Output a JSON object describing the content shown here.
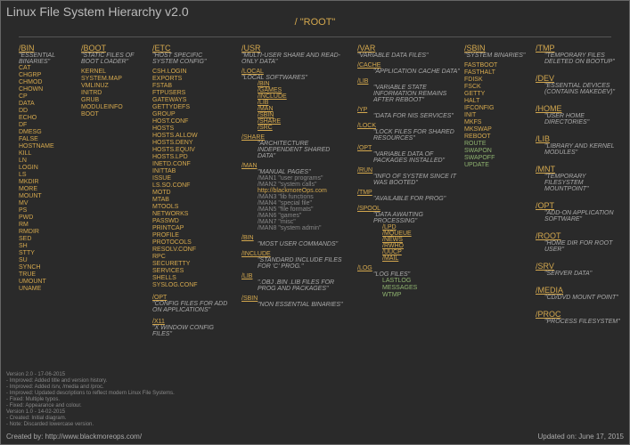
{
  "title": "Linux File System Hierarchy v2.0",
  "root": "/ \"ROOT\"",
  "cols": {
    "bin": {
      "label": "/BIN",
      "desc": "\"ESSENTIAL BINARIES\"",
      "items": [
        "CAT",
        "CHGRP",
        "CHMOD",
        "CHOWN",
        "CP",
        "DATA",
        "DD",
        "ECHO",
        "DF",
        "DMESG",
        "FALSE",
        "HOSTNAME",
        "KILL",
        "LN",
        "LOGIN",
        "LS",
        "MKDIR",
        "MORE",
        "MOUNT",
        "MV",
        "PS",
        "PWD",
        "RM",
        "RMDIR",
        "SED",
        "SH",
        "STTY",
        "SU",
        "SYNCH",
        "TRUE",
        "UMOUNT",
        "UNAME"
      ]
    },
    "boot": {
      "label": "/BOOT",
      "desc": "\"STATIC FILES OF BOOT LOADER\"",
      "items": [
        "KERNEL",
        "SYSTEM.MAP",
        "VMLINUZ",
        "INITRD",
        "GRUB",
        "MODULEINFO",
        "BOOT"
      ]
    },
    "etc": {
      "label": "/ETC",
      "desc": "\"HOST SPECIFIC SYSTEM CONFIG\"",
      "items": [
        "CSH.LOGIN",
        "EXPORTS",
        "FSTAB",
        "FTPUSERS",
        "GATEWAYS",
        "GETTYDEFS",
        "GROUP",
        "HOST.CONF",
        "HOSTS",
        "HOSTS.ALLOW",
        "HOSTS.DENY",
        "HOSTS.EQUIV",
        "HOSTS.LPD",
        "INETD.CONF",
        "INITTAB",
        "ISSUE",
        "LS.SO.CONF",
        "MOTD",
        "MTAB",
        "MTOOLS",
        "NETWORKS",
        "PASSWD",
        "PRINTCAP",
        "PROFILE",
        "PROTOCOLS",
        "RESOLV.CONF",
        "RPC",
        "SECURETTY",
        "SERVICES",
        "SHELLS",
        "SYSLOG.CONF"
      ],
      "opt": {
        "label": "/OPT",
        "desc": "\"CONFIG FILES FOR ADD ON APPLICATIONS\""
      },
      "x11": {
        "label": "/X11",
        "desc": "\"X WINDOW CONFIG FILES\""
      }
    },
    "usr": {
      "label": "/USR",
      "desc": "\"MULTI-USER SHARE AND READ-ONLY DATA\"",
      "local": {
        "label": "/LOCAL",
        "desc": "\"LOCAL SOFTWARES\"",
        "items": [
          "/BIN",
          "/GAMES",
          "/INCLUDE",
          "/LIB",
          "/MAN",
          "/SBIN",
          "/SHARE",
          "/SRC"
        ]
      },
      "share": {
        "label": "/SHARE",
        "desc": "\"ARCHITECTURE INDEPENDENT SHARED DATA\""
      },
      "man": {
        "label": "/MAN",
        "desc": "\"MANUAL PAGES\"",
        "items": [
          "/MAN1 \"user programs\"",
          "/MAN2 \"system calls\"",
          "/MAN3 \"lib functions",
          "/MAN4 \"special file\"",
          "/MAN5 \"file formats\"",
          "/MAN6 \"games\"",
          "/MAN7 \"misc\"",
          "/MAN8 \"system admin\""
        ],
        "hl": "http://blackmoreOps.com"
      },
      "binx": {
        "label": "/BIN",
        "desc": "\"MOST USER COMMANDS\""
      },
      "include": {
        "label": "/INCLUDE",
        "desc": "\"STANDARD INCLUDE FILES FOR 'C' PROG.\""
      },
      "lib": {
        "label": "/LIB",
        "desc": "\".OBJ .BIN .LIB FILES FOR PROG AND PACKAGES\""
      },
      "sbinx": {
        "label": "/SBIN",
        "desc": "\"NON ESSENTIAL BINARIES\""
      }
    },
    "var": {
      "label": "/VAR",
      "desc": "\"VARIABLE DATA FILES\"",
      "cache": {
        "label": "/CACHE",
        "desc": "\"APPLICATION CACHE DATA\""
      },
      "lib": {
        "label": "/LIB",
        "desc": "\"VARIABLE STATE INFORMATION REMAINS AFTER REBOOT\""
      },
      "yp": {
        "label": "/YP",
        "desc": "\"DATA FOR NIS SERVICES\""
      },
      "lock": {
        "label": "/LOCK",
        "desc": "\"LOCK FILES FOR SHARED RESOURCES\""
      },
      "opt": {
        "label": "/OPT",
        "desc": "\"VARIABLE DATA OF PACKAGES INSTALLED\""
      },
      "run": {
        "label": "/RUN",
        "desc": "\"INFO OF SYSTEM SINCE IT WAS BOOTED\""
      },
      "tmp": {
        "label": "/TMP",
        "desc": "\"AVAILABLE FOR PROG\""
      },
      "spool": {
        "label": "/SPOOL",
        "desc": "\"DATA AWAITING PROCESSING\"",
        "items": [
          "/LPD",
          "/MQUEUE",
          "/NEWS",
          "/RWHO",
          "/UUCP",
          "/MAIL"
        ]
      },
      "log": {
        "label": "/LOG",
        "desc": "\"LOG FILES\"",
        "items": [
          "LASTLOG",
          "MESSAGES",
          "WTMP"
        ]
      }
    },
    "sbin": {
      "label": "/SBIN",
      "desc": "\"SYSTEM BINARIES\"",
      "items": [
        "FASTBOOT",
        "FASTHALT",
        "FDISK",
        "FSCK",
        "GETTY",
        "HALT",
        "IFCONFIG",
        "INIT",
        "MKFS",
        "MKSWAP",
        "REBOOT",
        "ROUTE",
        "SWAPON",
        "SWAPOFF",
        "UPDATE"
      ]
    }
  },
  "side": [
    {
      "label": "/TMP",
      "desc": "\"TEMPORARY FILES DELETED ON BOOTUP\""
    },
    {
      "label": "/DEV",
      "desc": "\"ESSENTIAL DEVICES (CONTAINS MAKEDEV)\""
    },
    {
      "label": "/HOME",
      "desc": "\"USER HOME DIRECTORIES\""
    },
    {
      "label": "/LIB",
      "desc": "\"LIBRARY AND KERNEL MODULES\""
    },
    {
      "label": "/MNT",
      "desc": "\"TEMPORARY FILESYSTEM MOUNTPOINT\""
    },
    {
      "label": "/OPT",
      "desc": "\"ADD-ON APPLICATION SOFTWARE\""
    },
    {
      "label": "/ROOT",
      "desc": "\"HOME DIR FOR ROOT USER\""
    },
    {
      "label": "/SRV",
      "desc": "\"SERVER DATA\""
    },
    {
      "label": "/MEDIA",
      "desc": "\"CD/DVD MOUNT POINT\""
    },
    {
      "label": "/PROC",
      "desc": "\"PROCESS FILESYSTEM\""
    }
  ],
  "version": [
    "Version 2.0 - 17-06-2015",
    "- Improved: Added title and version history.",
    "- Improved: Added /srv, /media and /proc.",
    "- Improved: Updated descriptions to reflect modern Linux File Systems.",
    "- Fixed: Multiple typos.",
    "- Fixed: Appearance and colour.",
    "Version 1.0 - 14-02-2015",
    "- Created: Initial diagram.",
    "- Note: Discarded lowercase version."
  ],
  "footer": "Created by: http://www.blackmoreops.com/",
  "updated": "Updated on: June 17, 2015"
}
